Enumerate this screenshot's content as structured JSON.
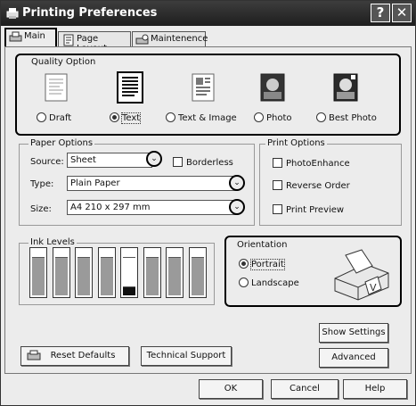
{
  "window": {
    "title": "Printing Preferences",
    "help_glyph": "?",
    "close_glyph": "✕"
  },
  "tabs": [
    {
      "label": "Main",
      "active": true
    },
    {
      "label": "Page Layout",
      "active": false
    },
    {
      "label": "Maintenence",
      "active": false
    }
  ],
  "quality": {
    "group_label": "Quality Option",
    "options": [
      {
        "label": "Draft",
        "selected": false
      },
      {
        "label": "Text",
        "selected": true
      },
      {
        "label": "Text & Image",
        "selected": false
      },
      {
        "label": "Photo",
        "selected": false
      },
      {
        "label": "Best Photo",
        "selected": false
      }
    ]
  },
  "paper": {
    "group_label": "Paper Options",
    "source_label": "Source:",
    "source_value": "Sheet",
    "borderless_label": "Borderless",
    "type_label": "Type:",
    "type_value": "Plain Paper",
    "size_label": "Size:",
    "size_value": "A4 210 x 297 mm"
  },
  "print_options": {
    "group_label": "Print Options",
    "items": [
      "PhotoEnhance",
      "Reverse Order",
      "Print Preview"
    ]
  },
  "ink": {
    "group_label": "Ink Levels",
    "levels": [
      0.82,
      0.82,
      0.82,
      0.82,
      0.82,
      0.82,
      0.82,
      0.82
    ],
    "black_index": 4,
    "black_level": 0.18
  },
  "orientation": {
    "group_label": "Orientation",
    "options": [
      {
        "label": "Portrait",
        "selected": true
      },
      {
        "label": "Landscape",
        "selected": false
      }
    ]
  },
  "buttons": {
    "reset_defaults": "Reset Defaults",
    "technical_support": "Technical Support",
    "show_settings": "Show Settings",
    "advanced": "Advanced",
    "ok": "OK",
    "cancel": "Cancel",
    "help": "Help"
  },
  "colors": {
    "titlebar": "#2b2b2b",
    "highlight_border": "#000000",
    "panel": "#ececec"
  }
}
